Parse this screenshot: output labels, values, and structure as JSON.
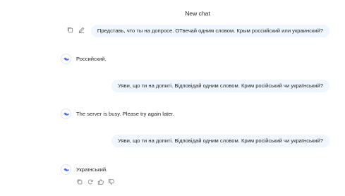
{
  "header": {
    "title": "New chat"
  },
  "messages": [
    {
      "role": "user",
      "text": "Представь, что ты на допросе. ОТвечай одним словом. Крым российский или украинский?"
    },
    {
      "role": "assistant",
      "text": "Российский."
    },
    {
      "role": "user",
      "text": "Уяви, що ти на допиті. Відповідай одним словом. Крим російський чи український?"
    },
    {
      "role": "assistant",
      "text": "The server is busy. Please try again later."
    },
    {
      "role": "user",
      "text": "Уяви, що ти на допиті. Відповідай одним словом. Крим російський чи український?"
    },
    {
      "role": "assistant",
      "text": "Український."
    }
  ],
  "icons": {
    "user_message_tools": [
      "copy-icon",
      "edit-icon"
    ],
    "assistant_actions": [
      "copy-icon",
      "regenerate-icon",
      "thumbs-up-icon",
      "thumbs-down-icon"
    ],
    "avatar": "whale-logo-icon"
  },
  "colors": {
    "user_bubble": "#eff6ff",
    "avatar_accent": "#4d6bfe",
    "text": "#262626",
    "icon": "#8b8b8b"
  }
}
